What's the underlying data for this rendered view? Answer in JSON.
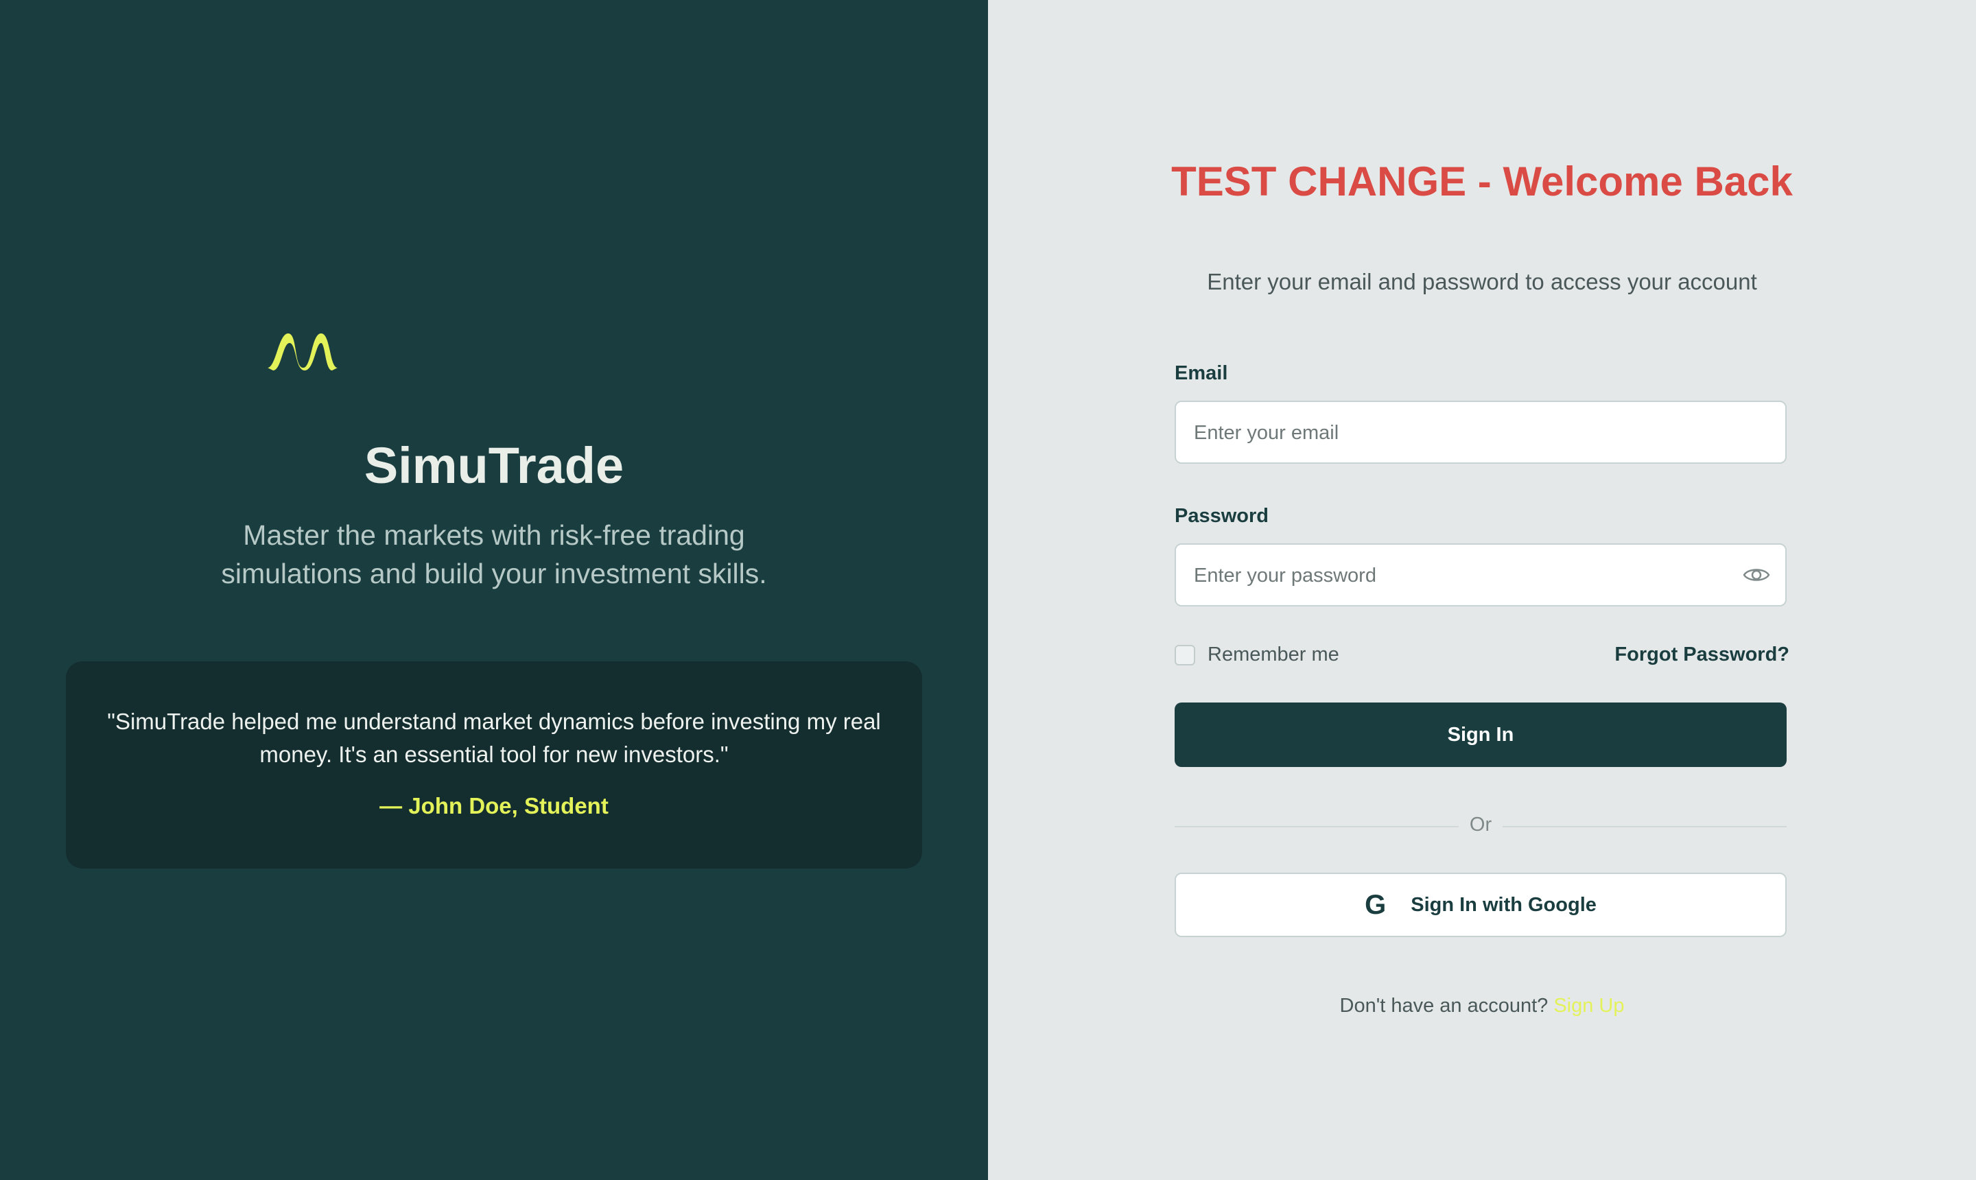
{
  "brand": {
    "name": "SimuTrade",
    "tagline": "Master the markets with risk-free trading simulations and build your investment skills.",
    "logo_icon": "wave-logo-icon",
    "accent": "#e4f25a"
  },
  "testimonial": {
    "quote": "\"SimuTrade helped me understand market dynamics before investing my real money. It's an essential tool for new investors.\"",
    "author": "— John Doe, Student"
  },
  "form": {
    "title": "TEST CHANGE - Welcome Back",
    "subtitle": "Enter your email and password to access your account",
    "email": {
      "label": "Email",
      "placeholder": "Enter your email",
      "value": ""
    },
    "password": {
      "label": "Password",
      "placeholder": "Enter your password",
      "value": "",
      "toggle_icon": "eye-icon"
    },
    "remember_label": "Remember me",
    "remember_checked": false,
    "forgot_label": "Forgot Password?",
    "sign_in_label": "Sign In",
    "divider_label": "Or",
    "google_label": "Sign In with Google",
    "google_icon": "google-icon",
    "signup_prompt": "Don't have an account?",
    "signup_link": "Sign Up"
  },
  "colors": {
    "panel_dark": "#1a3d3f",
    "panel_light": "#e5e8e8",
    "title_red": "#d94b44"
  }
}
